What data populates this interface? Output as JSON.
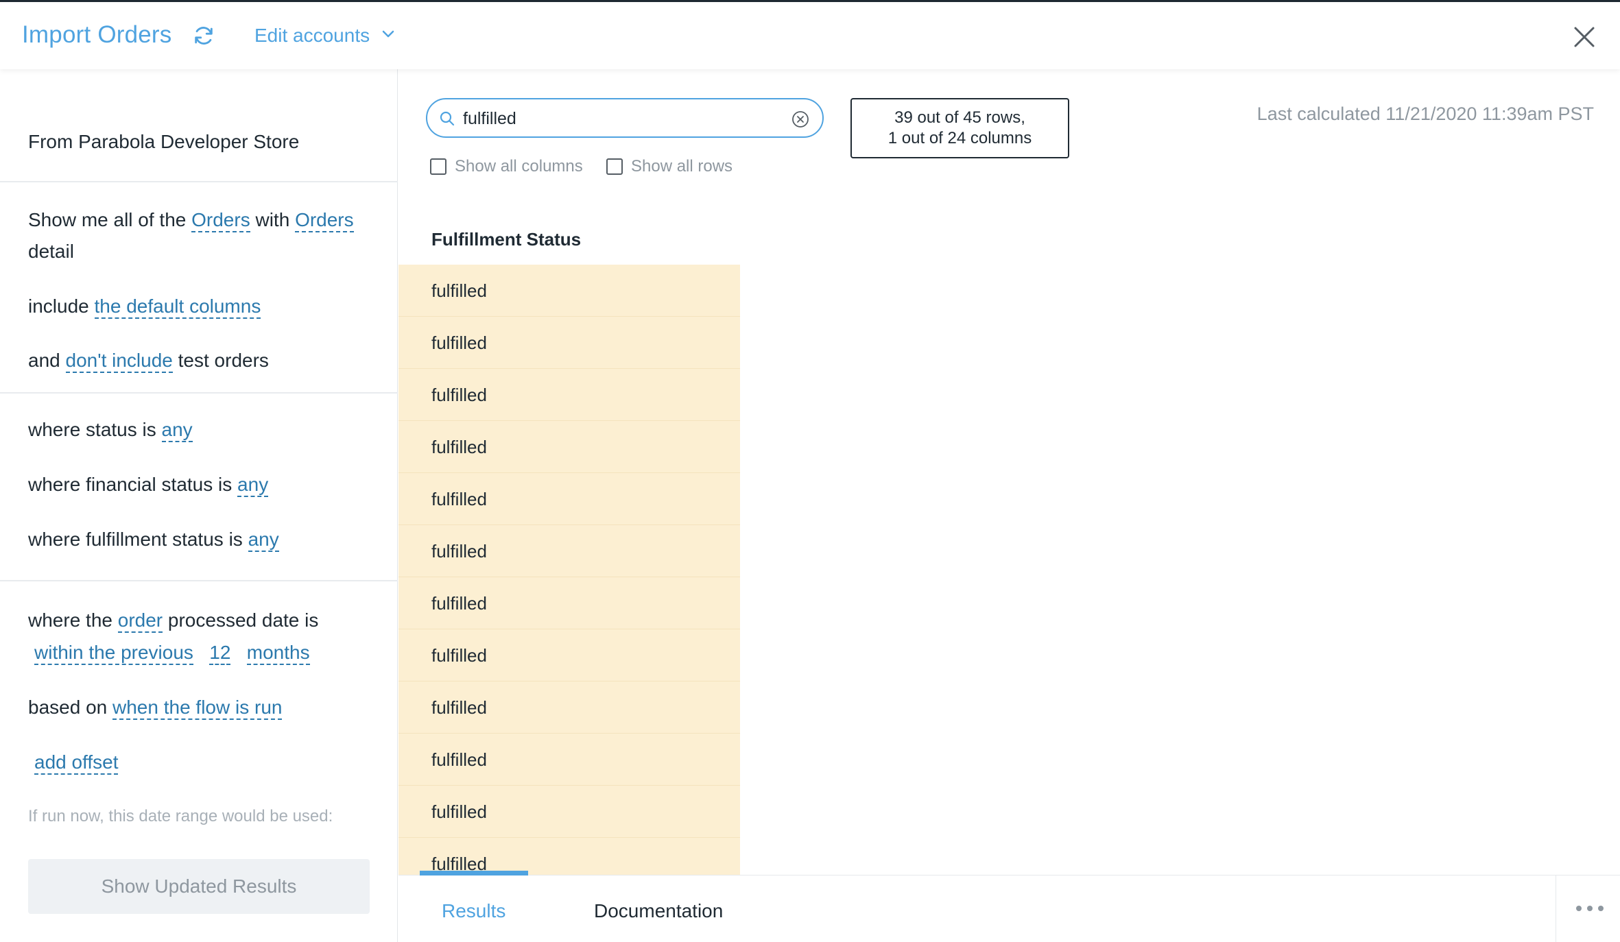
{
  "header": {
    "title": "Import Orders",
    "edit_accounts_label": "Edit accounts"
  },
  "left_panel": {
    "source": "From Parabola Developer Store",
    "query": {
      "show_prefix": "Show me all of the",
      "entity": "Orders",
      "with": "with",
      "detail_entity": "Orders",
      "detail_suffix": "detail",
      "include_prefix": "include",
      "include_value": "the default columns",
      "and_prefix": "and",
      "test_value": "don't include",
      "test_suffix": "test orders"
    },
    "filters": {
      "status_prefix": "where status is",
      "status_value": "any",
      "financial_prefix": "where financial status is",
      "financial_value": "any",
      "fulfillment_prefix": "where fulfillment status is",
      "fulfillment_value": "any"
    },
    "date": {
      "where_the": "where the",
      "date_field": "order",
      "processed_suffix": "processed date is",
      "range_type": "within the previous",
      "range_amount": "12",
      "range_unit": "months",
      "based_on_prefix": "based on",
      "based_on_value": "when the flow is run",
      "add_offset": "add offset",
      "hint": "If run now, this date range would be used:"
    },
    "show_results_button": "Show Updated Results"
  },
  "main": {
    "search": {
      "value": "fulfilled",
      "placeholder": "Search"
    },
    "row_count": "39 out of 45 rows,",
    "col_count": "1 out of 24 columns",
    "last_calculated": "Last calculated 11/21/2020 11:39am PST",
    "show_all_columns": "Show all columns",
    "show_all_rows": "Show all rows",
    "table": {
      "column": "Fulfillment Status",
      "rows": [
        "fulfilled",
        "fulfilled",
        "fulfilled",
        "fulfilled",
        "fulfilled",
        "fulfilled",
        "fulfilled",
        "fulfilled",
        "fulfilled",
        "fulfilled",
        "fulfilled",
        "fulfilled"
      ]
    }
  },
  "bottom": {
    "tabs": [
      "Results",
      "Documentation"
    ],
    "active_tab": "Results"
  },
  "colors": {
    "accent": "#4fa3e0",
    "token": "#2b79ad",
    "highlight": "#fcefd2"
  },
  "icons": [
    "refresh-icon",
    "chevron-down-icon",
    "close-icon",
    "search-icon",
    "clear-search-icon",
    "more-icon"
  ]
}
